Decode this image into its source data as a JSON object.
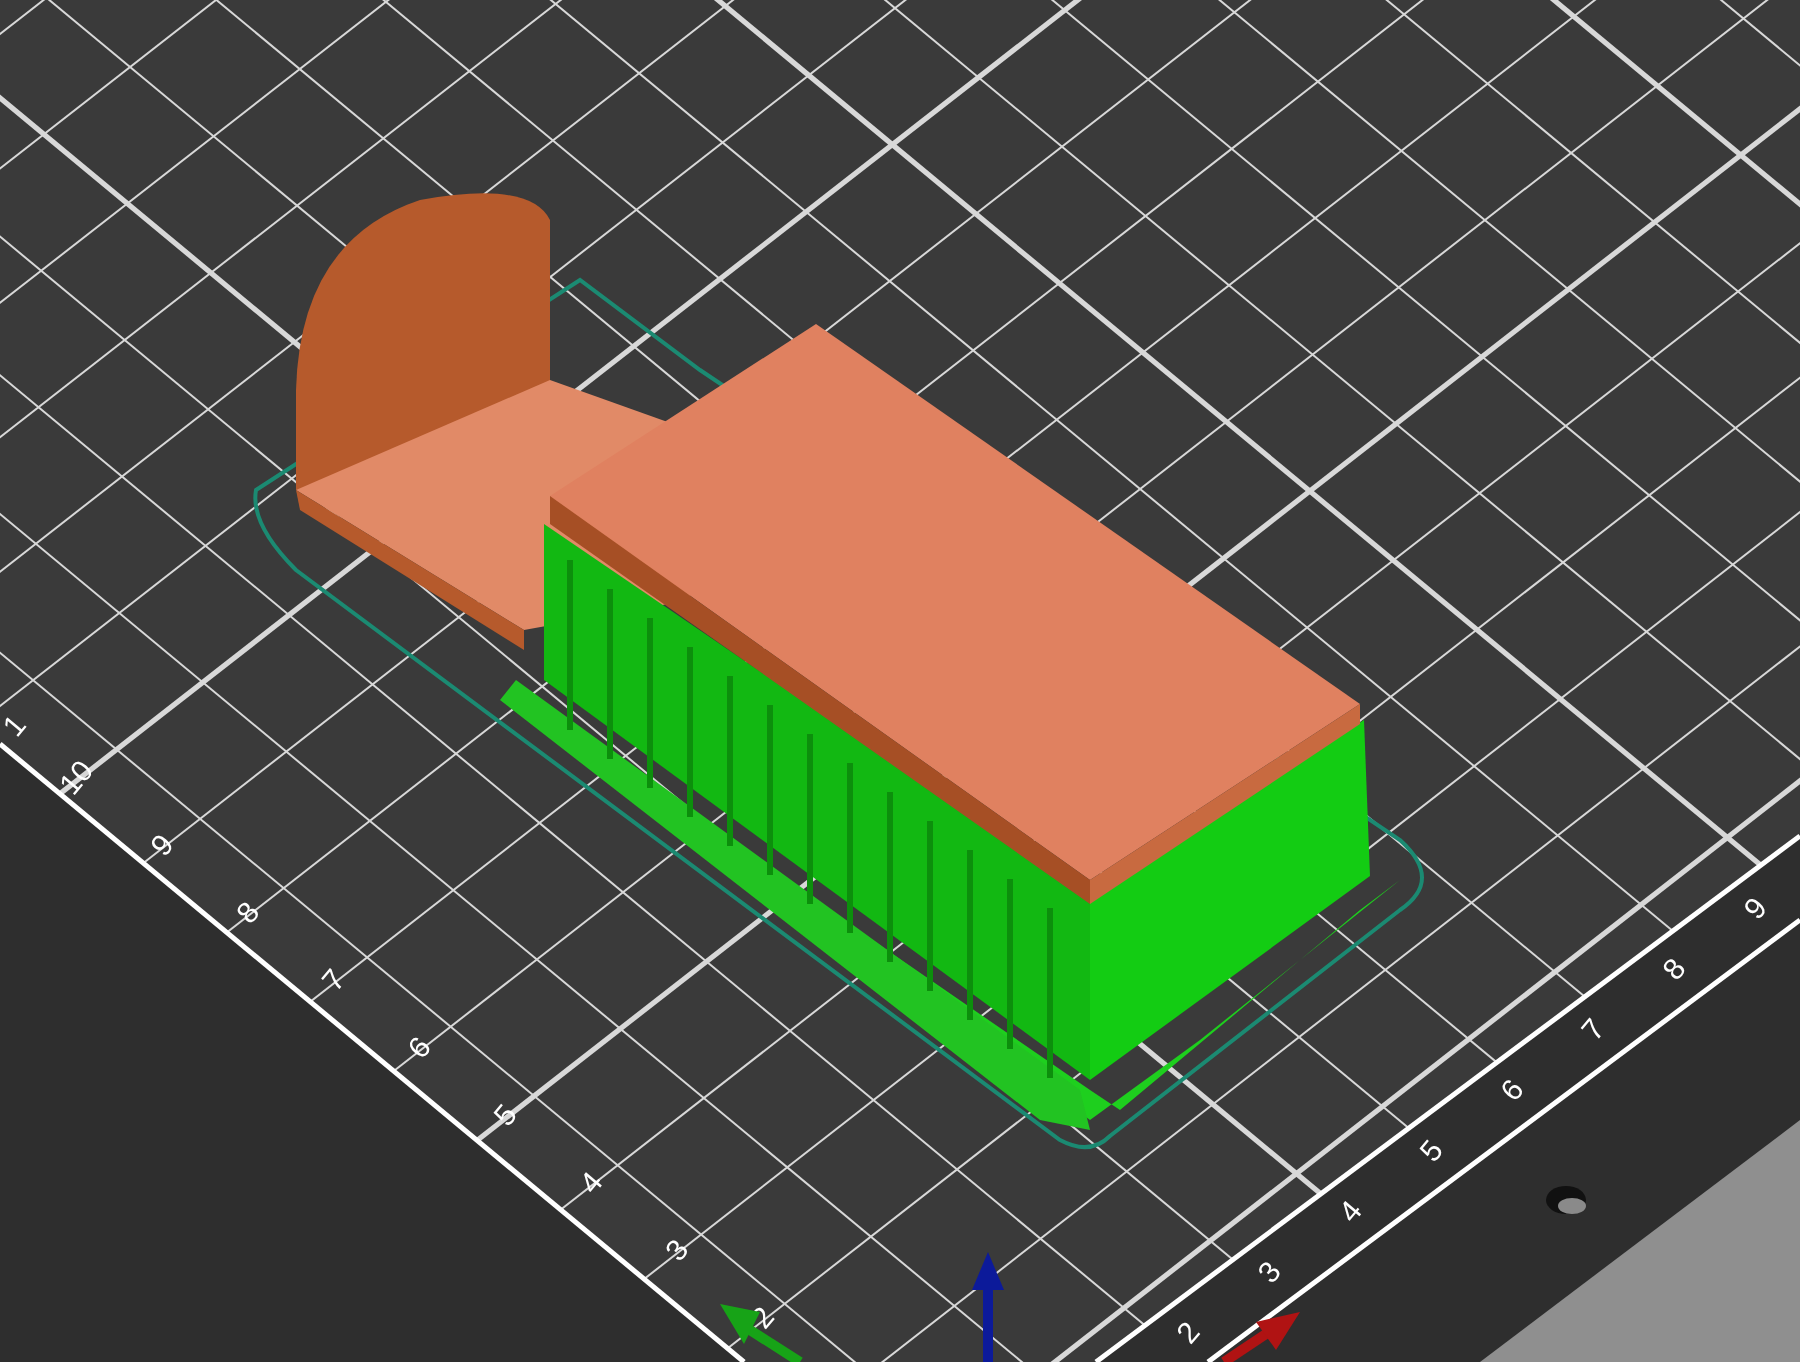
{
  "bed": {
    "left_scale": [
      "1",
      "10",
      "9",
      "8",
      "7",
      "6",
      "5",
      "4",
      "3",
      "2"
    ],
    "front_scale": [
      "2",
      "3",
      "4",
      "5",
      "6",
      "7",
      "8",
      "9"
    ]
  }
}
